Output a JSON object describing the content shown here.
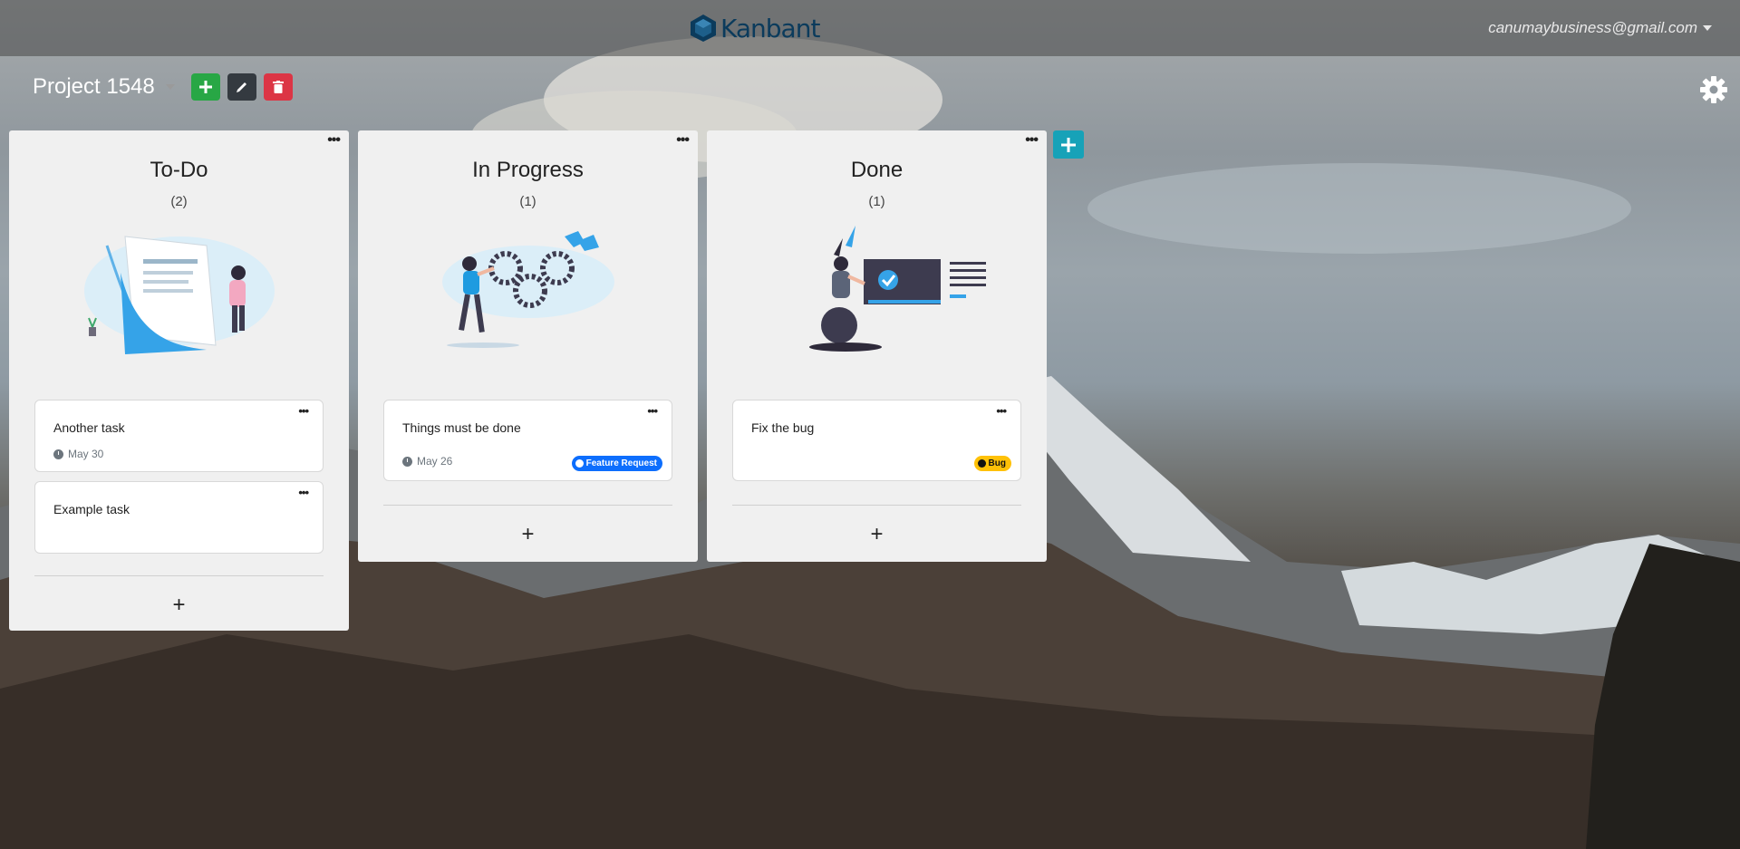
{
  "navbar": {
    "brand": "Kanbant",
    "user_email": "canumaybusiness@gmail.com"
  },
  "project": {
    "title": "Project 1548",
    "add_icon": "plus-icon",
    "edit_icon": "pencil-icon",
    "delete_icon": "trash-icon"
  },
  "settings_icon": "gear-icon",
  "columns": [
    {
      "title": "To-Do",
      "count": "(2)",
      "cards": [
        {
          "title": "Another task",
          "date": "May 30"
        },
        {
          "title": "Example task"
        }
      ],
      "add_label": "+"
    },
    {
      "title": "In Progress",
      "count": "(1)",
      "cards": [
        {
          "title": "Things must be done",
          "date": "May 26",
          "tag": "Feature Request"
        }
      ],
      "add_label": "+"
    },
    {
      "title": "Done",
      "count": "(1)",
      "cards": [
        {
          "title": "Fix the bug",
          "tag": "Bug"
        }
      ],
      "add_label": "+"
    }
  ],
  "add_column_icon": "plus-icon",
  "colors": {
    "green": "#28a745",
    "dark": "#343a40",
    "red": "#dc3545",
    "teal": "#17a2b8",
    "feature_tag": "#0d6efd",
    "bug_tag": "#ffc107",
    "brand": "#0b3b5c"
  }
}
